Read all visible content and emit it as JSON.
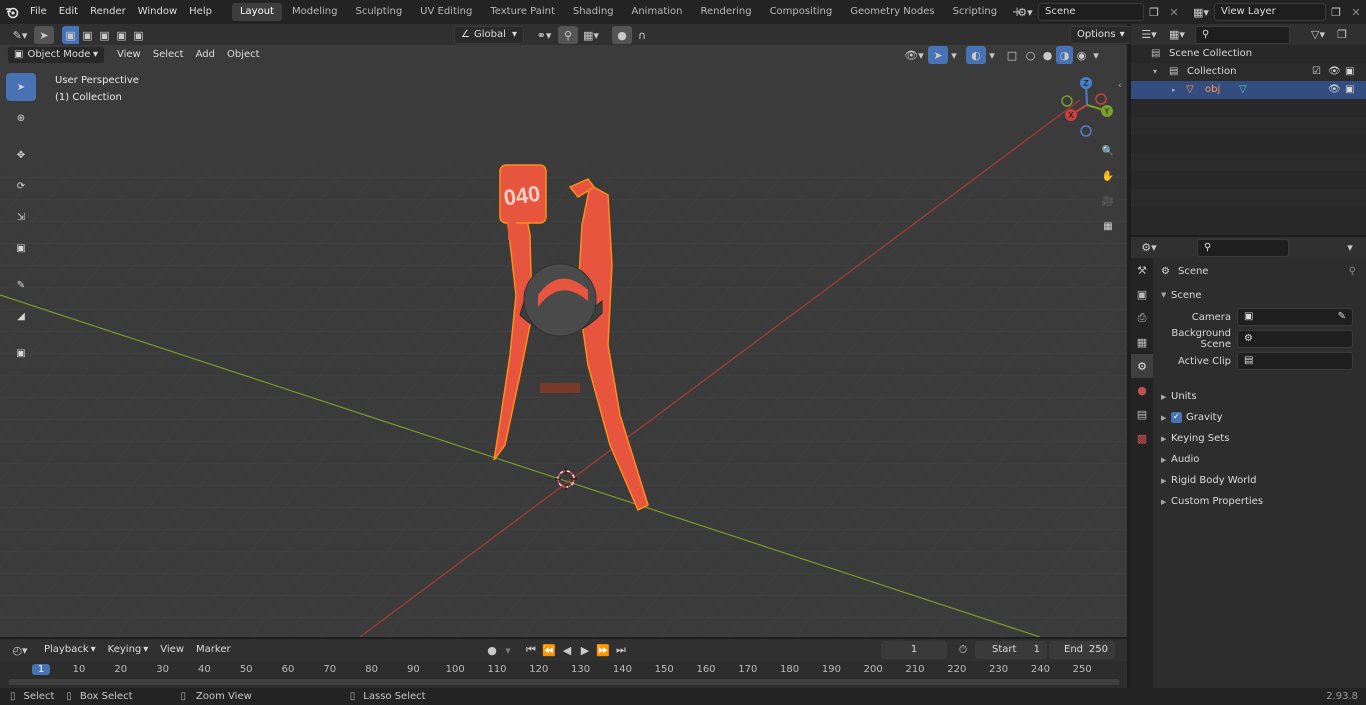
{
  "menu": {
    "items": [
      "File",
      "Edit",
      "Render",
      "Window",
      "Help"
    ]
  },
  "workspaces": [
    "Layout",
    "Modeling",
    "Sculpting",
    "UV Editing",
    "Texture Paint",
    "Shading",
    "Animation",
    "Rendering",
    "Compositing",
    "Geometry Nodes",
    "Scripting"
  ],
  "active_workspace": "Layout",
  "scene_field": "Scene",
  "view_layer_field": "View Layer",
  "viewport_header": {
    "transform_orientation": "Global",
    "options_label": "Options",
    "mode": "Object Mode",
    "menus": [
      "View",
      "Select",
      "Add",
      "Object"
    ]
  },
  "viewport": {
    "perspective_label": "User Perspective",
    "collection_label": "(1) Collection",
    "tag_text": "040",
    "gizmo": {
      "z": "Z",
      "y": "Y",
      "x": "X"
    }
  },
  "outliner": {
    "search_placeholder": "",
    "rows": [
      {
        "label": "Scene Collection",
        "icon": "scene-collection-icon"
      },
      {
        "label": "Collection",
        "icon": "collection-icon"
      },
      {
        "label": "obj",
        "icon": "mesh-object-icon"
      }
    ]
  },
  "properties": {
    "breadcrumb": "Scene",
    "section": "Scene",
    "fields": [
      {
        "label": "Camera",
        "value": ""
      },
      {
        "label": "Background Scene",
        "value": ""
      },
      {
        "label": "Active Clip",
        "value": ""
      }
    ],
    "panels": [
      {
        "label": "Units",
        "checkbox": false
      },
      {
        "label": "Gravity",
        "checkbox": true
      },
      {
        "label": "Keying Sets",
        "checkbox": false
      },
      {
        "label": "Audio",
        "checkbox": false
      },
      {
        "label": "Rigid Body World",
        "checkbox": false
      },
      {
        "label": "Custom Properties",
        "checkbox": false
      }
    ]
  },
  "timeline": {
    "menus": [
      "Playback",
      "Keying",
      "View",
      "Marker"
    ],
    "current_frame": "1",
    "start_label": "Start",
    "start_value": "1",
    "end_label": "End",
    "end_value": "250",
    "ruler": [
      "1",
      "10",
      "20",
      "30",
      "40",
      "50",
      "60",
      "70",
      "80",
      "90",
      "100",
      "110",
      "120",
      "130",
      "140",
      "150",
      "160",
      "170",
      "180",
      "190",
      "200",
      "210",
      "220",
      "230",
      "240",
      "250"
    ]
  },
  "statusbar": {
    "items": [
      "Select",
      "Box Select",
      "Zoom View",
      "Lasso Select"
    ],
    "version": "2.93.8"
  },
  "colors": {
    "accent": "#4772b3",
    "object": "#e8553e",
    "object_outline": "#ff8c1a",
    "x_axis": "#a83a3a",
    "y_axis": "#7a9a2b",
    "viewport_bg": "#3b3b3b"
  }
}
